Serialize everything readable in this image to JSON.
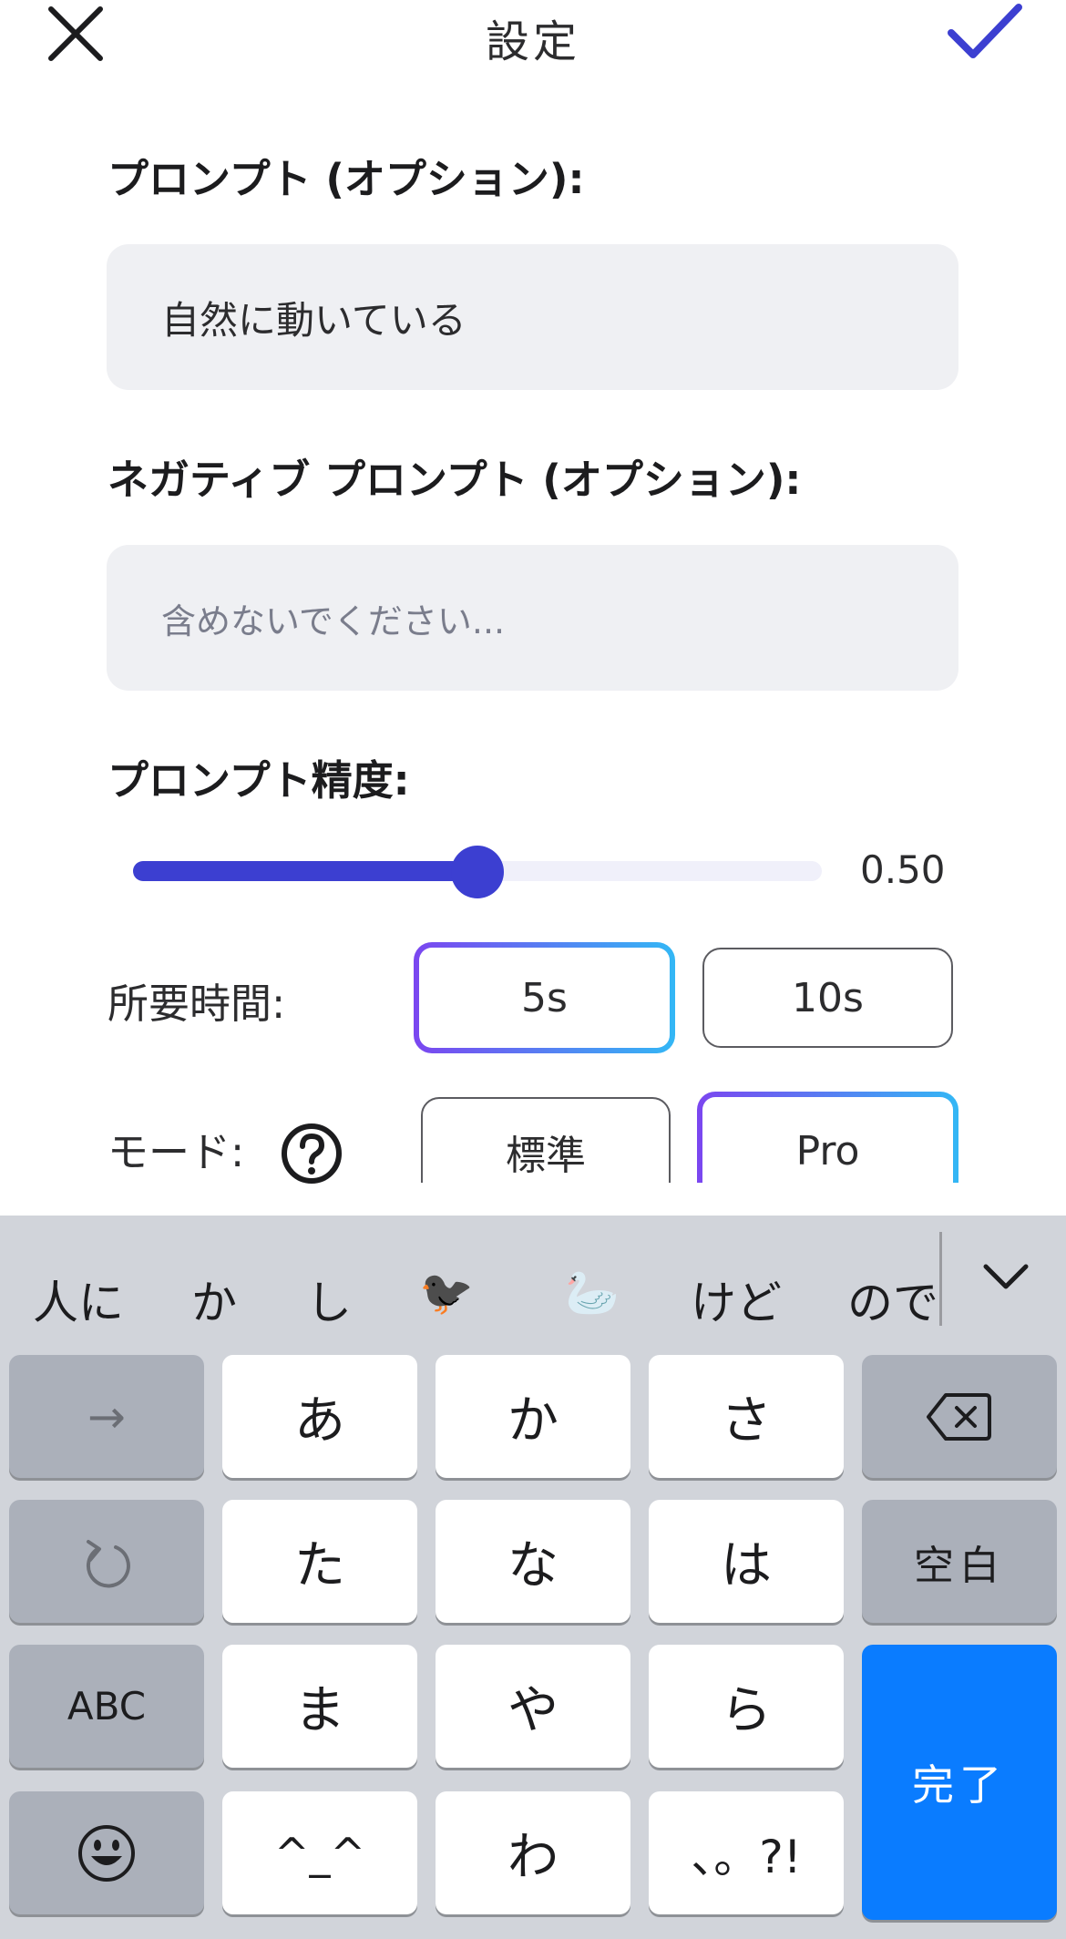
{
  "header": {
    "title": "設定",
    "close_icon": "close-icon",
    "confirm_icon": "checkmark-icon",
    "accent_color": "#3c3fd1"
  },
  "prompt": {
    "label": "プロンプト (オプション):",
    "value": "自然に動いている"
  },
  "negative_prompt": {
    "label": "ネガティブ プロンプト (オプション):",
    "placeholder": "含めないでください..."
  },
  "accuracy": {
    "label": "プロンプト精度:",
    "value_text": "0.50",
    "fraction": 0.5
  },
  "duration": {
    "label": "所要時間:",
    "options": [
      "5s",
      "10s"
    ],
    "selected": "5s"
  },
  "mode": {
    "label": "モード:",
    "help_icon": "help-circle-icon",
    "options": [
      "標準",
      "Pro"
    ],
    "selected": "Pro"
  },
  "keyboard": {
    "suggestions": [
      "人に",
      "か",
      "し",
      "🐦‍⬛",
      "🦢",
      "けど",
      "ので"
    ],
    "collapse_icon": "chevron-down-icon",
    "keys": {
      "arrow": "→",
      "a": "あ",
      "ka": "か",
      "sa": "さ",
      "backspace_icon": "backspace-icon",
      "undo_icon": "undo-icon",
      "ta": "た",
      "na": "な",
      "ha": "は",
      "space": "空白",
      "abc": "ABC",
      "ma": "ま",
      "ya": "や",
      "ra": "ら",
      "done": "完了",
      "emoji_icon": "emoji-icon",
      "kaomoji": "^_^",
      "wa": "わ",
      "punct": "、。?!"
    }
  }
}
